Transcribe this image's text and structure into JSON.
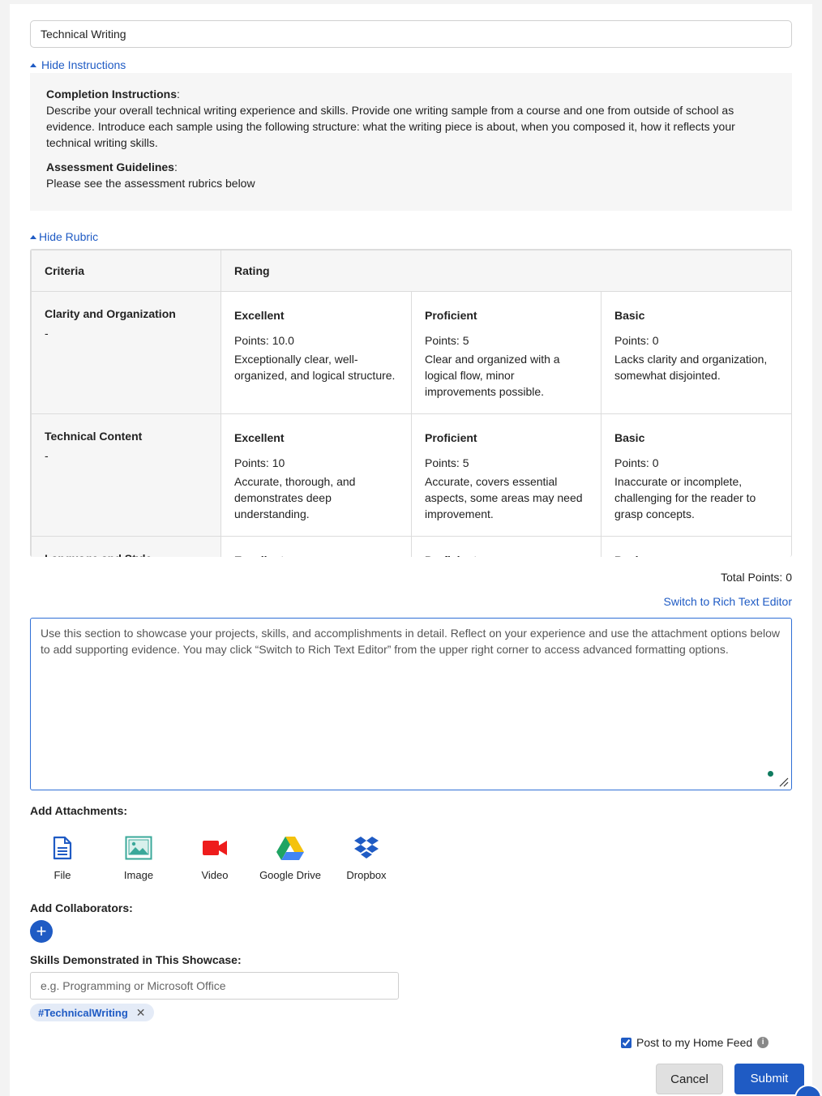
{
  "title_input": {
    "value": "Technical Writing"
  },
  "instructions": {
    "toggle_label": "Hide Instructions",
    "completion_heading": "Completion Instructions",
    "completion_text": "Describe your overall technical writing experience and skills. Provide one writing sample from a course and one from outside of school as evidence. Introduce each sample using the following structure: what the writing piece is about, when you composed it, how it reflects your technical writing skills.",
    "assessment_heading": "Assessment Guidelines",
    "assessment_text": "Please see the assessment rubrics below"
  },
  "rubric": {
    "toggle_label": "Hide Rubric",
    "headers": {
      "criteria": "Criteria",
      "rating": "Rating"
    },
    "rows": [
      {
        "criterion": "Clarity and Organization",
        "dash": "-",
        "levels": [
          {
            "name": "Excellent",
            "points": "Points: 10.0",
            "desc": "Exceptionally clear, well-organized, and logical structure."
          },
          {
            "name": "Proficient",
            "points": "Points: 5",
            "desc": "Clear and organized with a logical flow, minor improvements possible."
          },
          {
            "name": "Basic",
            "points": "Points: 0",
            "desc": "Lacks clarity and organization, somewhat disjointed."
          }
        ]
      },
      {
        "criterion": "Technical Content",
        "dash": "-",
        "levels": [
          {
            "name": "Excellent",
            "points": "Points: 10",
            "desc": "Accurate, thorough, and demonstrates deep understanding."
          },
          {
            "name": "Proficient",
            "points": "Points: 5",
            "desc": "Accurate, covers essential aspects, some areas may need improvement."
          },
          {
            "name": "Basic",
            "points": "Points: 0",
            "desc": "Inaccurate or incomplete, challenging for the reader to grasp concepts."
          }
        ]
      },
      {
        "criterion": "Language and Style",
        "dash": "",
        "levels": [
          {
            "name": "Excellent",
            "points": "",
            "desc": ""
          },
          {
            "name": "Proficient",
            "points": "",
            "desc": ""
          },
          {
            "name": "Basic",
            "points": "",
            "desc": ""
          }
        ]
      }
    ],
    "total_points": "Total Points: 0"
  },
  "editor": {
    "switch_label": "Switch to Rich Text Editor",
    "placeholder": "Use this section to showcase your projects, skills, and accomplishments in detail. Reflect on your experience and use the attachment options below to add supporting evidence. You may click “Switch to Rich Text Editor” from the upper right corner to access advanced formatting options."
  },
  "attachments": {
    "label": "Add Attachments:",
    "items": [
      {
        "label": "File",
        "icon": "file-icon",
        "color": "#1f5bc4"
      },
      {
        "label": "Image",
        "icon": "image-icon",
        "color": "#3aa89a"
      },
      {
        "label": "Video",
        "icon": "video-camera-icon",
        "color": "#ee1c1c"
      },
      {
        "label": "Google Drive",
        "icon": "google-drive-icon",
        "color": "#1fa463"
      },
      {
        "label": "Dropbox",
        "icon": "dropbox-icon",
        "color": "#1f5bc4"
      }
    ]
  },
  "collaborators": {
    "label": "Add Collaborators:"
  },
  "skills": {
    "label": "Skills Demonstrated in This Showcase:",
    "placeholder": "e.g. Programming or Microsoft Office",
    "tags": [
      "#TechnicalWriting"
    ]
  },
  "post_feed": {
    "label": "Post to my Home Feed",
    "checked": true
  },
  "buttons": {
    "cancel": "Cancel",
    "submit": "Submit"
  },
  "colors": {
    "accent": "#1f5bc4",
    "panel_bg": "#f6f6f6",
    "page_bg": "#f3f3f3"
  }
}
